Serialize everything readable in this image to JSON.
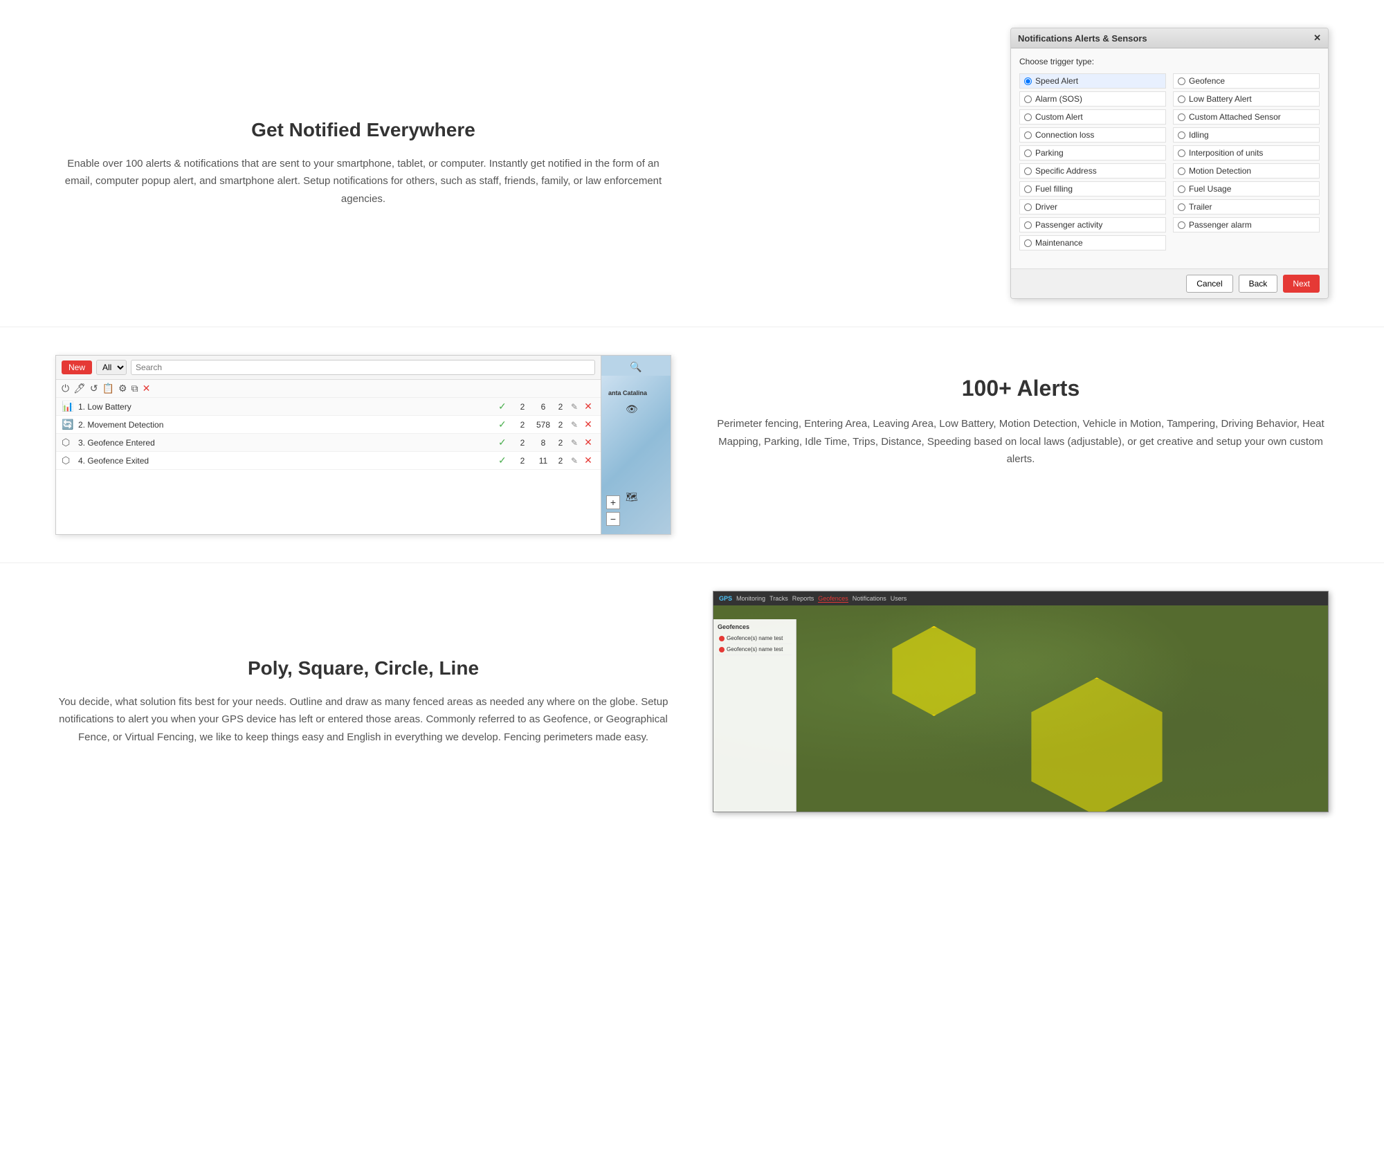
{
  "section1": {
    "title": "Get Notified Everywhere",
    "description": "Enable over 100 alerts & notifications that are sent to your smartphone, tablet, or computer. Instantly get notified in the form of an email, computer popup alert, and smartphone alert. Setup notifications for others, such as staff, friends, family, or law enforcement agencies.",
    "dialog": {
      "title": "Notifications Alerts & Sensors",
      "label": "Choose trigger type:",
      "options_left": [
        {
          "label": "Speed Alert",
          "selected": true
        },
        {
          "label": "Alarm (SOS)",
          "selected": false
        },
        {
          "label": "Custom Alert",
          "selected": false
        },
        {
          "label": "Connection loss",
          "selected": false
        },
        {
          "label": "Parking",
          "selected": false
        },
        {
          "label": "Specific Address",
          "selected": false
        },
        {
          "label": "Fuel filling",
          "selected": false
        },
        {
          "label": "Driver",
          "selected": false
        },
        {
          "label": "Passenger activity",
          "selected": false
        },
        {
          "label": "Maintenance",
          "selected": false
        }
      ],
      "options_right": [
        {
          "label": "Geofence",
          "selected": false
        },
        {
          "label": "Low Battery Alert",
          "selected": false
        },
        {
          "label": "Custom Attached Sensor",
          "selected": false
        },
        {
          "label": "Idling",
          "selected": false
        },
        {
          "label": "Interposition of units",
          "selected": false
        },
        {
          "label": "Motion Detection",
          "selected": false
        },
        {
          "label": "Fuel Usage",
          "selected": false
        },
        {
          "label": "Trailer",
          "selected": false
        },
        {
          "label": "Passenger alarm",
          "selected": false
        }
      ],
      "btn_cancel": "Cancel",
      "btn_back": "Back",
      "btn_next": "Next"
    }
  },
  "section2": {
    "title": "100+ Alerts",
    "description": "Perimeter fencing, Entering Area, Leaving Area, Low Battery, Motion Detection, Vehicle in Motion, Tampering, Driving Behavior, Heat Mapping, Parking, Idle Time, Trips, Distance, Speeding based on local laws (adjustable), or get creative and setup your own custom alerts.",
    "panel": {
      "btn_new": "New",
      "filter_options": [
        "All"
      ],
      "search_placeholder": "Search",
      "alerts": [
        {
          "icon": "📊",
          "name": "1. Low Battery",
          "checked": true,
          "count1": 2,
          "count2": 6,
          "count3": 2
        },
        {
          "icon": "🔄",
          "name": "2. Movement Detection",
          "checked": true,
          "count1": 2,
          "count2": 578,
          "count3": 2
        },
        {
          "icon": "⬡",
          "name": "3. Geofence Entered",
          "checked": true,
          "count1": 2,
          "count2": 8,
          "count3": 2
        },
        {
          "icon": "⬡",
          "name": "4. Geofence Exited",
          "checked": true,
          "count1": 2,
          "count2": 11,
          "count3": 2
        }
      ],
      "map_label": "anta Catalina"
    }
  },
  "section3": {
    "title": "Poly, Square, Circle, Line",
    "description": "You decide, what solution fits best for your needs. Outline and draw as many fenced areas as needed any where on the globe. Setup notifications to alert you when your GPS device has left or entered those areas. Commonly referred to as Geofence, or Geographical Fence, or Virtual Fencing, we like to keep things easy and English in everything we develop. Fencing perimeters made easy.",
    "geo_map": {
      "tabs": [
        "Monitoring",
        "Tracks",
        "Reports",
        "Geofences",
        "Notifications",
        "Users"
      ],
      "active_tab": "Geofences",
      "sidebar_items": [
        "Geofence(s) name test",
        "Geofence(s) name test"
      ]
    }
  }
}
